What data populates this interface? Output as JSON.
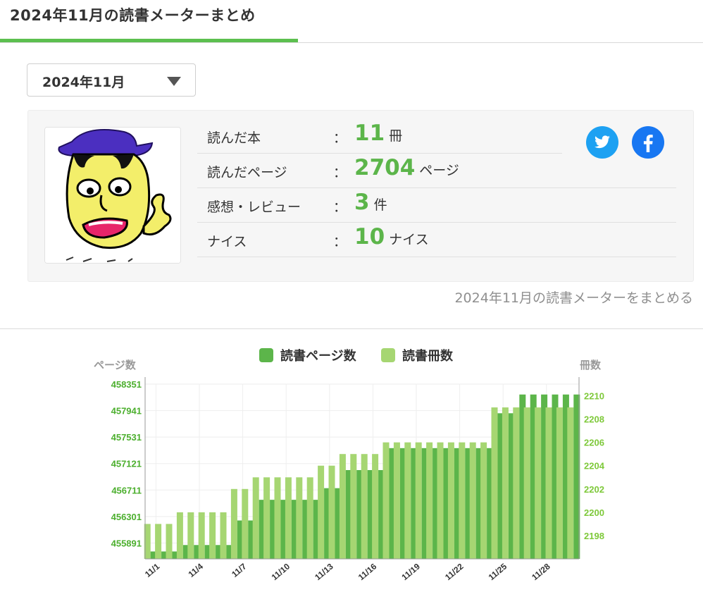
{
  "header": {
    "title": "2024年11月の読書メーターまとめ"
  },
  "month_select": {
    "value": "2024年11月"
  },
  "summary": {
    "rows": [
      {
        "label": "読んだ本",
        "value": "11",
        "unit": "冊"
      },
      {
        "label": "読んだページ",
        "value": "2704",
        "unit": "ページ"
      },
      {
        "label": "感想・レビュー",
        "value": "3",
        "unit": "件"
      },
      {
        "label": "ナイス",
        "value": "10",
        "unit": "ナイス"
      }
    ],
    "colon": "："
  },
  "social": {
    "twitter_icon": "twitter-icon",
    "facebook_icon": "facebook-icon",
    "twitter_color": "#1da1f2",
    "facebook_color": "#1877f2"
  },
  "summarize_link": "2024年11月の読書メーターをまとめる",
  "colors": {
    "accent": "#5cbf4f",
    "pages_series": "#5cb54a",
    "books_series": "#a6d672"
  },
  "chart_data": {
    "type": "bar",
    "legend": {
      "placement": "top-center",
      "items": [
        "読書ページ数",
        "読書冊数"
      ]
    },
    "left_axis": {
      "label": "ページ数",
      "ticks": [
        455891,
        456301,
        456711,
        457121,
        457531,
        457941,
        458351
      ],
      "range": [
        455645,
        458351
      ]
    },
    "right_axis": {
      "label": "冊数",
      "ticks": [
        2198,
        2200,
        2202,
        2204,
        2206,
        2208,
        2210
      ],
      "range": [
        2196,
        2211
      ]
    },
    "x_tick_labels": [
      "11/1",
      "11/4",
      "11/7",
      "11/10",
      "11/13",
      "11/16",
      "11/19",
      "11/22",
      "11/25",
      "11/28"
    ],
    "x": [
      "11/1",
      "11/2",
      "11/3",
      "11/4",
      "11/5",
      "11/6",
      "11/7",
      "11/8",
      "11/9",
      "11/10",
      "11/11",
      "11/12",
      "11/13",
      "11/14",
      "11/15",
      "11/16",
      "11/17",
      "11/18",
      "11/19",
      "11/20",
      "11/21",
      "11/22",
      "11/23",
      "11/24",
      "11/25",
      "11/26",
      "11/27",
      "11/28",
      "11/29",
      "11/30"
    ],
    "series": [
      {
        "name": "読書ページ数",
        "axis": "left",
        "values": [
          455760,
          455760,
          455760,
          455860,
          455860,
          455860,
          455860,
          455860,
          456240,
          456240,
          456560,
          456560,
          456560,
          456560,
          456560,
          456560,
          456740,
          456740,
          457020,
          457020,
          457020,
          457020,
          457360,
          457360,
          457360,
          457360,
          457360,
          457360,
          457360,
          457360,
          457360,
          457360,
          457900,
          457900,
          458190,
          458190,
          458190,
          458190,
          458190,
          458190
        ]
      },
      {
        "name": "読書冊数",
        "axis": "right",
        "values": [
          2199,
          2199,
          2199,
          2200,
          2200,
          2200,
          2200,
          2200,
          2202,
          2202,
          2203,
          2203,
          2203,
          2203,
          2203,
          2203,
          2204,
          2204,
          2205,
          2205,
          2205,
          2205,
          2206,
          2206,
          2206,
          2206,
          2206,
          2206,
          2206,
          2206,
          2206,
          2206,
          2209,
          2209,
          2209,
          2209,
          2209,
          2209,
          2209,
          2209
        ]
      }
    ],
    "grid": true
  }
}
